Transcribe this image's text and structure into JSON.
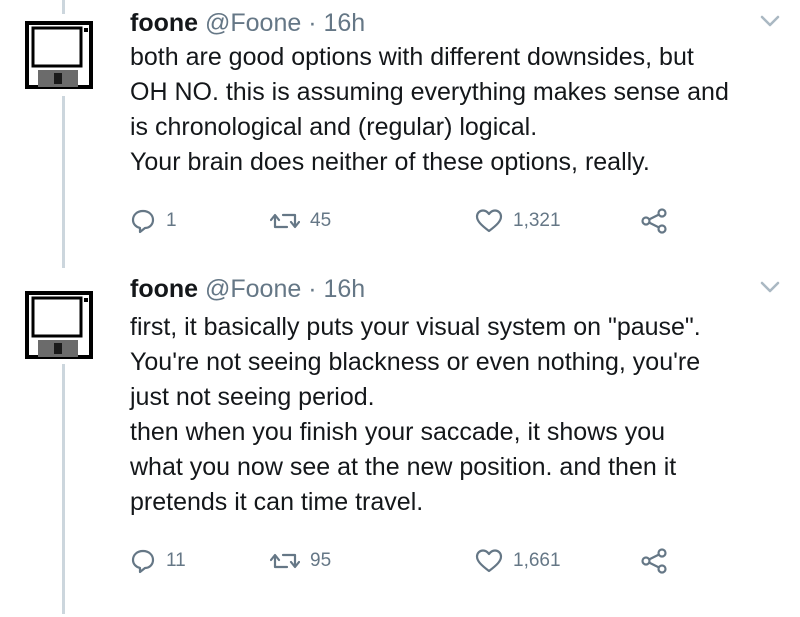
{
  "thread": {
    "tweets": [
      {
        "name": "foone",
        "handle": "@Foone",
        "separator": "·",
        "time": "16h",
        "lines": [
          "both are good options with different downsides, but",
          "OH NO. this is assuming everything makes sense and",
          "is chronological and (regular) logical.",
          "Your brain does neither of these options, really."
        ],
        "replies": "1",
        "retweets": "45",
        "likes": "1,321",
        "icons": [
          "floppy-disk-avatar",
          "chevron-down-icon",
          "reply-icon",
          "retweet-icon",
          "heart-icon",
          "share-icon"
        ]
      },
      {
        "name": "foone",
        "handle": "@Foone",
        "separator": "·",
        "time": "16h",
        "lines": [
          "first, it basically puts your visual system on \"pause\".",
          "You're not seeing blackness or even nothing, you're",
          "just not seeing period.",
          "then when you finish your saccade, it shows you",
          "what you now see at the new position. and then it",
          "pretends it can time travel."
        ],
        "replies": "11",
        "retweets": "95",
        "likes": "1,661",
        "icons": [
          "floppy-disk-avatar",
          "chevron-down-icon",
          "reply-icon",
          "retweet-icon",
          "heart-icon",
          "share-icon"
        ]
      }
    ]
  },
  "colors": {
    "text": "#14171a",
    "secondary": "#657786",
    "thread_line": "#ccd6dd"
  }
}
